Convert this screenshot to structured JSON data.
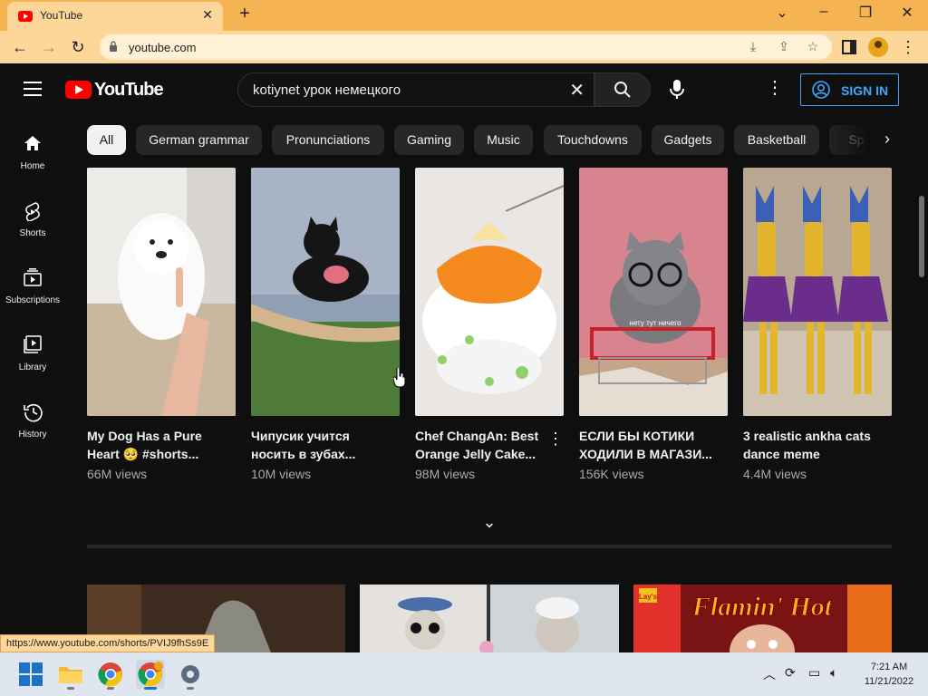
{
  "browser": {
    "tab_title": "YouTube",
    "tab_close": "✕",
    "new_tab": "+",
    "url": "youtube.com",
    "status_url": "https://www.youtube.com/shorts/PVIJ9fhSs9E"
  },
  "header": {
    "logo_text": "YouTube",
    "search_query": "kotiynet урок немецкого",
    "sign_in_label": "SIGN IN"
  },
  "sidebar": {
    "items": [
      {
        "label": "Home",
        "icon": "home-icon"
      },
      {
        "label": "Shorts",
        "icon": "shorts-icon"
      },
      {
        "label": "Subscriptions",
        "icon": "subscriptions-icon"
      },
      {
        "label": "Library",
        "icon": "library-icon"
      },
      {
        "label": "History",
        "icon": "history-icon"
      }
    ]
  },
  "chips": [
    "All",
    "German grammar",
    "Pronunciations",
    "Gaming",
    "Music",
    "Touchdowns",
    "Gadgets",
    "Basketball",
    "Sp"
  ],
  "shorts": [
    {
      "title": "My Dog Has a Pure Heart 🥺 #shorts...",
      "views": "66M views"
    },
    {
      "title": "Чипусик учится носить в зубах...",
      "views": "10M views"
    },
    {
      "title": "Chef ChangAn: Best Orange Jelly Cake...",
      "views": "98M views"
    },
    {
      "title": "ЕСЛИ БЫ КОТИКИ ХОДИЛИ В МАГАЗИ...",
      "views": "156K views"
    },
    {
      "title": "3 realistic ankha cats dance meme",
      "views": "4.4M views"
    }
  ],
  "thumb_texts": {
    "cat_caption": "нету тут ничего",
    "flamin_hot": "Flamin' Hot",
    "lays": "Lay's"
  },
  "taskbar": {
    "time": "7:21 AM",
    "date": "11/21/2022"
  },
  "colors": {
    "browser_frame": "#f6b352",
    "youtube_red": "#ff0000",
    "sign_in_blue": "#3ea6ff",
    "page_bg": "#0f0f0f"
  }
}
